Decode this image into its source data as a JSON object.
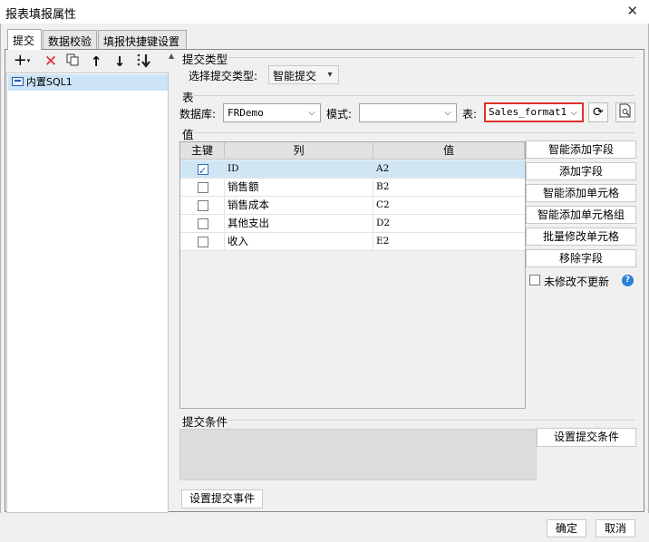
{
  "window": {
    "title": "报表填报属性"
  },
  "tabs": [
    {
      "label": "提交"
    },
    {
      "label": "数据校验"
    },
    {
      "label": "填报快捷键设置"
    }
  ],
  "left_panel": {
    "tree_items": [
      {
        "label": "内置SQL1"
      }
    ]
  },
  "submit_type": {
    "section_label": "提交类型",
    "select_label": "选择提交类型:",
    "selected": "智能提交"
  },
  "table_section": {
    "section_label": "表",
    "database_label": "数据库:",
    "database_value": "FRDemo",
    "schema_label": "模式:",
    "schema_value": "",
    "table_label": "表:",
    "table_value": "Sales_format1"
  },
  "value_section": {
    "section_label": "值",
    "columns": [
      "主键",
      "列",
      "值"
    ],
    "rows": [
      {
        "key": true,
        "column": "ID",
        "value": "A2"
      },
      {
        "key": false,
        "column": "销售额",
        "value": "B2"
      },
      {
        "key": false,
        "column": "销售成本",
        "value": "C2"
      },
      {
        "key": false,
        "column": "其他支出",
        "value": "D2"
      },
      {
        "key": false,
        "column": "收入",
        "value": "E2"
      }
    ],
    "buttons": {
      "smart_add_field": "智能添加字段",
      "add_field": "添加字段",
      "smart_add_cell": "智能添加单元格",
      "smart_add_cell_group": "智能添加单元格组",
      "batch_modify_cell": "批量修改单元格",
      "remove_field": "移除字段"
    },
    "no_update_unmodified_label": "未修改不更新"
  },
  "submit_condition": {
    "section_label": "提交条件",
    "set_condition_button": "设置提交条件"
  },
  "set_event_button": "设置提交事件",
  "footer": {
    "ok": "确定",
    "cancel": "取消"
  },
  "colors": {
    "selection": "#cde4f7",
    "highlight_border": "#e0302a",
    "help": "#2b80d8"
  }
}
